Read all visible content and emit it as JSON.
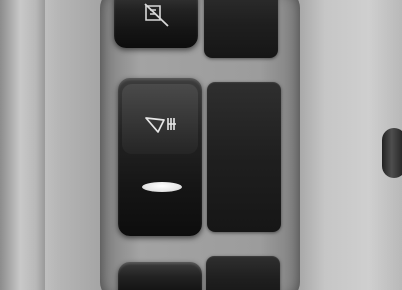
{
  "scene": {
    "description_tags": [
      "vehicle-dashboard",
      "rocker-switch-panel"
    ],
    "colors": {
      "switch_body": "#111111",
      "indicator_light": "#f2f2f2",
      "panel_plastic": "#a6a6a6"
    },
    "icons": {
      "top_switch": "headlight-off-icon",
      "main_switch": "work-light-icon"
    }
  }
}
